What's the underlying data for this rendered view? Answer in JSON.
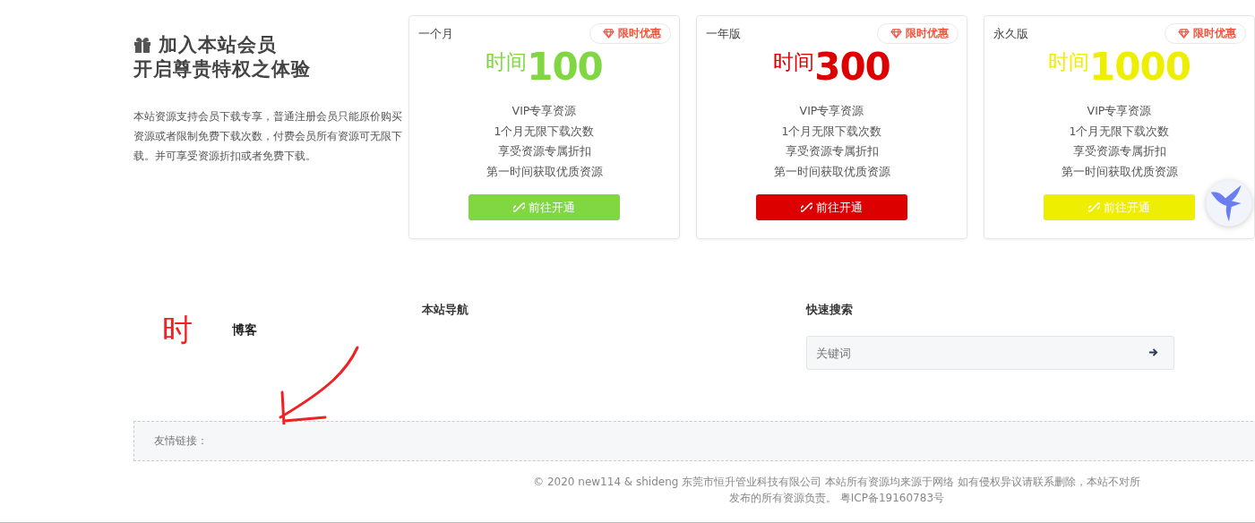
{
  "intro": {
    "title_lines": [
      "加入本站会员",
      "开启尊贵特权之体验"
    ],
    "description": "本站资源支持会员下载专享，普通注册会员只能原价购买资源或者限制免费下载次数，付费会员所有资源可无限下载。并可享受资源折扣或者免费下载。"
  },
  "plans": [
    {
      "name": "一个月",
      "badge": "限时优惠",
      "price_label": "时间",
      "price": "100",
      "color": "#81d742",
      "features": [
        "VIP专享资源",
        "1个月无限下载次数",
        "享受资源专属折扣",
        "第一时间获取优质资源"
      ],
      "button": "前往开通"
    },
    {
      "name": "一年版",
      "badge": "限时优惠",
      "price_label": "时间",
      "price": "300",
      "color": "#dd0000",
      "features": [
        "VIP专享资源",
        "1个月无限下载次数",
        "享受资源专属折扣",
        "第一时间获取优质资源"
      ],
      "button": "前往开通"
    },
    {
      "name": "永久版",
      "badge": "限时优惠",
      "price_label": "时间",
      "price": "1000",
      "color": "#eeee00",
      "features": [
        "VIP专享资源",
        "1个月无限下载次数",
        "享受资源专属折扣",
        "第一时间获取优质资源"
      ],
      "button": "前往开通"
    }
  ],
  "footer": {
    "logo_mark": "时",
    "logo_text": "博客",
    "nav_title": "本站导航",
    "search_title": "快速搜索",
    "search": {
      "placeholder": "关键词"
    },
    "links_label": "友情链接：",
    "copyright_lines": [
      "© 2020 new114 & shideng 东莞市恒升管业科技有限公司 本站所有资源均来源于网络 如有侵权异议请联系删除，本站不对所",
      "发布的所有资源负责。 粤ICP备19160783号"
    ]
  }
}
